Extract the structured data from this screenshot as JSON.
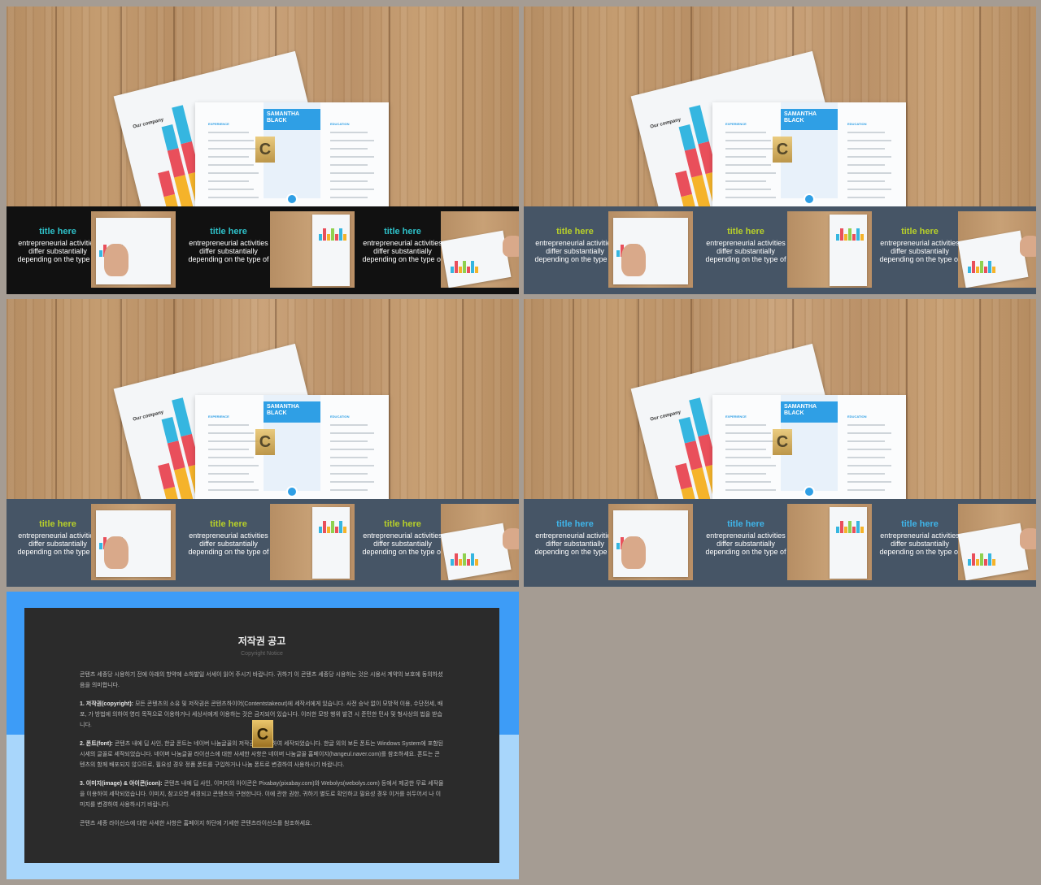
{
  "slides": [
    {
      "strip_color": "#111111",
      "title_color": "#2ec0c8",
      "cells": [
        {
          "title": "title here",
          "body": "entrepreneurial activities differ substantially depending on the type of"
        },
        {
          "title": "title here",
          "body": "entrepreneurial activities differ substantially depending on the type of"
        },
        {
          "title": "title here",
          "body": "entrepreneurial activities differ substantially depending on the type of"
        }
      ]
    },
    {
      "strip_color": "#465566",
      "title_color": "#b7cf2a",
      "cells": [
        {
          "title": "title here",
          "body": "entrepreneurial activities differ substantially depending on the type of"
        },
        {
          "title": "title here",
          "body": "entrepreneurial activities differ substantially depending on the type of"
        },
        {
          "title": "title here",
          "body": "entrepreneurial activities differ substantially depending on the type of"
        }
      ]
    },
    {
      "strip_color": "#465566",
      "title_color": "#b7cf2a",
      "cells": [
        {
          "title": "title here",
          "body": "entrepreneurial activities differ substantially depending on the type of"
        },
        {
          "title": "title here",
          "body": "entrepreneurial activities differ substantially depending on the type of"
        },
        {
          "title": "title here",
          "body": "entrepreneurial activities differ substantially depending on the type of"
        }
      ]
    },
    {
      "strip_color": "#465566",
      "title_color": "#3fb4e8",
      "cells": [
        {
          "title": "title here",
          "body": "entrepreneurial activities differ substantially depending on the type of"
        },
        {
          "title": "title here",
          "body": "entrepreneurial activities differ substantially depending on the type of"
        },
        {
          "title": "title here",
          "body": "entrepreneurial activities differ substantially depending on the type of"
        }
      ]
    }
  ],
  "photo": {
    "paper_label": "Our company",
    "resume_name": "SAMANTHA BLACK",
    "experience_label": "EXPERIENCE",
    "education_label": "EDUCATION",
    "logo_letter": "C",
    "bar_colors": [
      "#35b6e0",
      "#e94f5b",
      "#f5b32a"
    ]
  },
  "notice": {
    "title": "저작권 공고",
    "subtitle": "Copyright Notice",
    "intro": "콘텐츠 세종당 시용하기 전에 아래의 항약에 소하발일 서세이 읽어 주시기 바랍니다. 귀하기 이 콘텐츠 세종당 시용하는 것은 시용서 계약의 보호에 동의하셨음을 의미합니다.",
    "s1_head": "1. 저작권(copyright):",
    "s1_body": "모든 콘텐츠의 소유 및 저작권은 콘텐츠하이어(Contentstakeout)에 세작서에게 있습니다. 사전 승낙 없이 모방적 이용, 수단전세, 배포, 가 방법에 의하여 영리 목적으로 이용하거나 세상서에게 이용하는 것은 금지되어 있습니다. 이러한 모방 행위 발견 시 준민한 민사 및 형사상의 법을 받습니다.",
    "s2_head": "2. 폰트(font):",
    "s2_body": "콘텐츠 내에 딥 사인, 한글 폰트는 네이버 나눔글꼴의 저작권을 준용하여 세작되었습니다. 한글 외의 보든 폰트는 Windows System에 포함된 시세의 글꼴로 세작되었습니다. 네이버 나눔글꼴 라이선스에 대한 사세한 사항은 네이버 나눔글꼴 홈페이지(hangeul.naver.com)를 참조하세요. 폰트는 콘텐츠의 함께 배포되지 않으므로, 필요성 경우 정품 폰트를 구입하거나 나눔 폰트로 변경하여 사용하시기 바랍니다.",
    "s3_head": "3. 이미지(image) & 아이콘(icon):",
    "s3_body": "콘텐츠 내에 딥 사인, 이미지의 아이콘은 Pixabay(pixabay.com)와 Webolys(webolys.com) 등에서 제공한 무료 세작물을 이용하여 세작되었습니다. 이미지, 참고으면 세경되고 콘텐츠의 구현한니다. 이에 관한 권한, 귀하기 별도로 확인하고 필요성 경우 이거를 쉬두어서 나 이미지를 변경하여 사용하시기 바랍니다.",
    "footer": "콘텐츠 세종 라이선스에 대한 사세한 사항은 홈페이지 하단에 기세한 콘텐츠라이선스를 참조하세요.",
    "logo_letter": "C"
  }
}
